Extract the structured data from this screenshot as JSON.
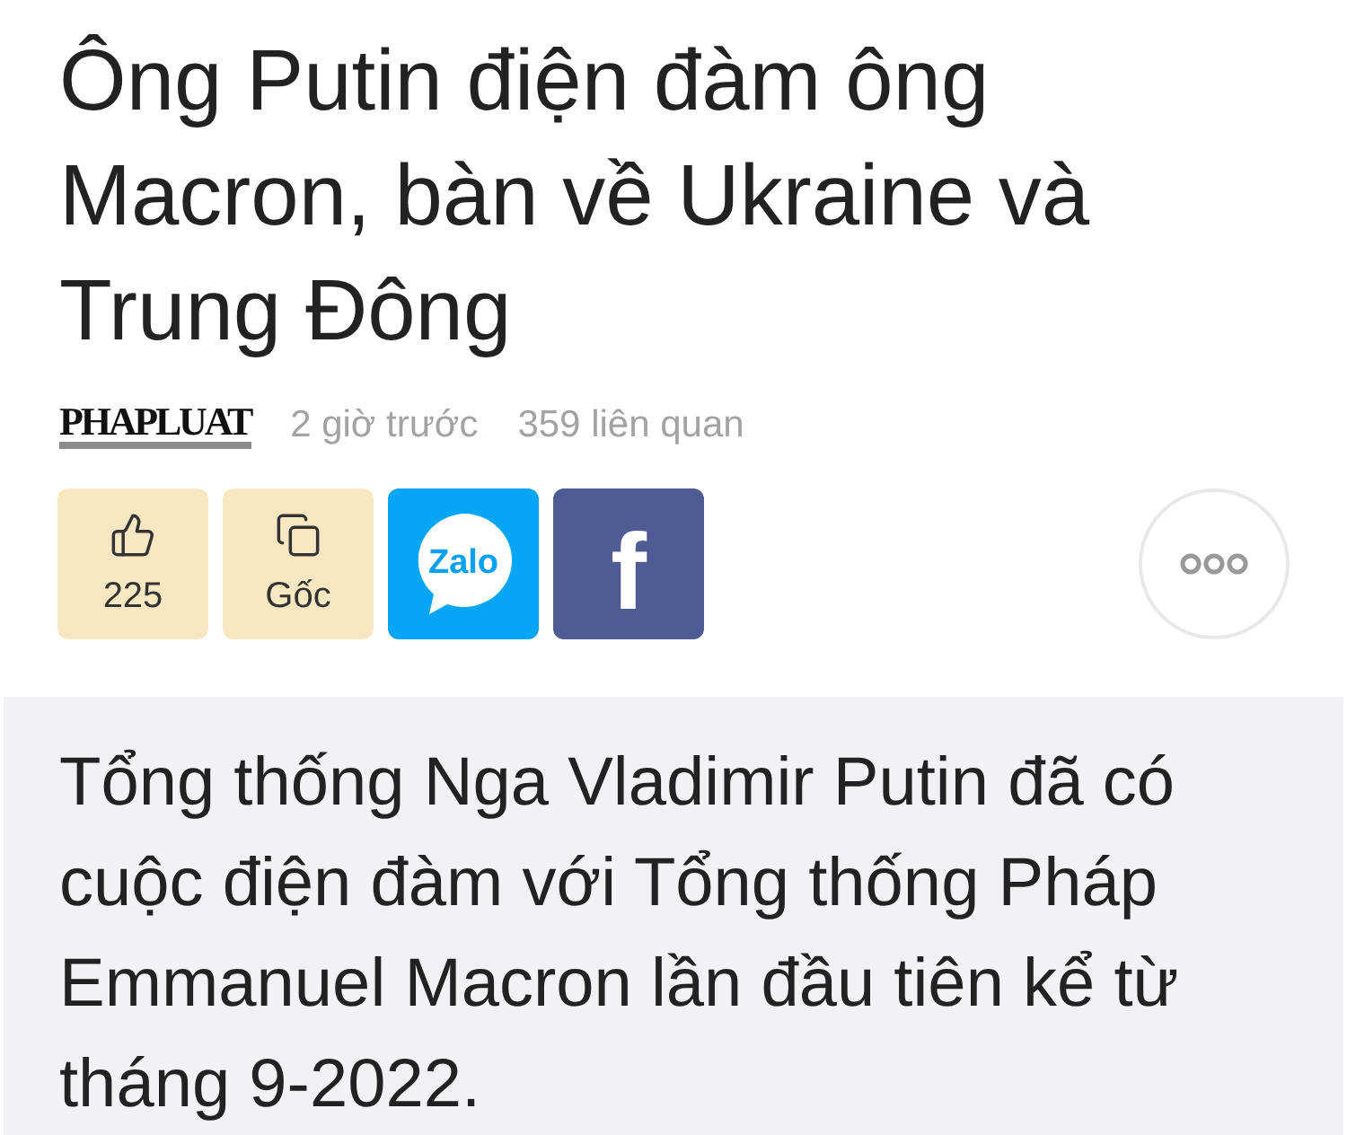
{
  "article": {
    "title": "Ông Putin điện đàm ông Macron, bàn về Ukraine và Trung Đông",
    "source": {
      "logo": "PHAPLUAT",
      "time": "2 giờ trước",
      "related": "359 liên quan"
    },
    "actions": [
      {
        "kind": "like",
        "label": "225"
      },
      {
        "kind": "source",
        "label": "Gốc"
      },
      {
        "kind": "zalo",
        "label": "Zalo"
      },
      {
        "kind": "facebook",
        "label": "f"
      }
    ],
    "lead": "Tổng thống Nga Vladimir Putin đã có cuộc điện đàm với Tổng thống Pháp Emmanuel Macron lần đầu tiên kể từ tháng 9-2022."
  }
}
